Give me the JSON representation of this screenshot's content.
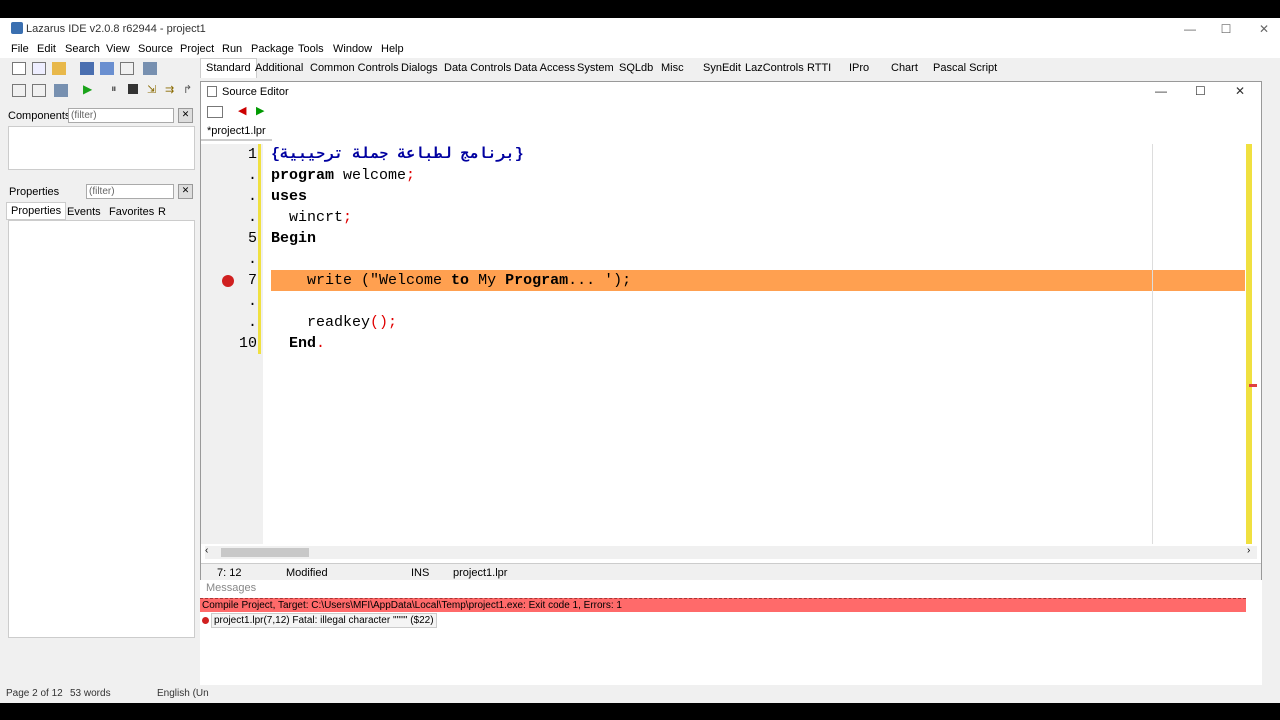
{
  "window": {
    "title": "Lazarus IDE v2.0.8 r62944 - project1"
  },
  "menu": [
    "File",
    "Edit",
    "Search",
    "View",
    "Source",
    "Project",
    "Run",
    "Package",
    "Tools",
    "Window",
    "Help"
  ],
  "palette_tabs": [
    "Standard",
    "Additional",
    "Common Controls",
    "Dialogs",
    "Data Controls",
    "Data Access",
    "System",
    "SQLdb",
    "Misc",
    "SynEdit",
    "LazControls",
    "RTTI",
    "IPro",
    "Chart",
    "Pascal Script"
  ],
  "left": {
    "components_label": "Components",
    "components_filter": "(filter)",
    "properties_label": "Properties",
    "properties_filter": "(filter)",
    "tabs": [
      "Properties",
      "Events",
      "Favorites",
      "R"
    ]
  },
  "editor": {
    "title": "Source Editor",
    "tab": "*project1.lpr",
    "line_numbers": [
      "1",
      ".",
      ".",
      ".",
      "5",
      ".",
      "7",
      ".",
      ".",
      "10"
    ],
    "lines": {
      "l1": "{برنامج لطباعة جملة ترحيبية}",
      "l2_kw": "program",
      "l2_rest": " welcome",
      "l2_sym": ";",
      "l3_kw": "uses",
      "l4_rest": "  wincrt",
      "l4_sym": ";",
      "l5_kw": "Begin",
      "l7_a": "    write (\"",
      "l7_b": "Welcome ",
      "l7_kw1": "to",
      "l7_c": " My ",
      "l7_kw2": "Program",
      "l7_d": "... ');",
      "l9_a": "    readkey",
      "l9_sym": "();",
      "l10_kw": "  End",
      "l10_sym": "."
    },
    "status": {
      "pos": "7: 12",
      "state": "Modified",
      "mode": "INS",
      "file": "project1.lpr"
    }
  },
  "messages": {
    "header": "Messages",
    "compile": "Compile Project, Target: C:\\Users\\MFI\\AppData\\Local\\Temp\\project1.exe: Exit code 1, Errors: 1",
    "error": "project1.lpr(7,12) Fatal: illegal character \"'\"'\" ($22)"
  },
  "doc_status": {
    "page": "Page 2 of 12",
    "words": "53 words",
    "lang": "English (Un"
  },
  "colors": {
    "highlight": "#ffa050",
    "error_bar": "#ff6a6a",
    "gutter_mark": "#f0e040"
  }
}
